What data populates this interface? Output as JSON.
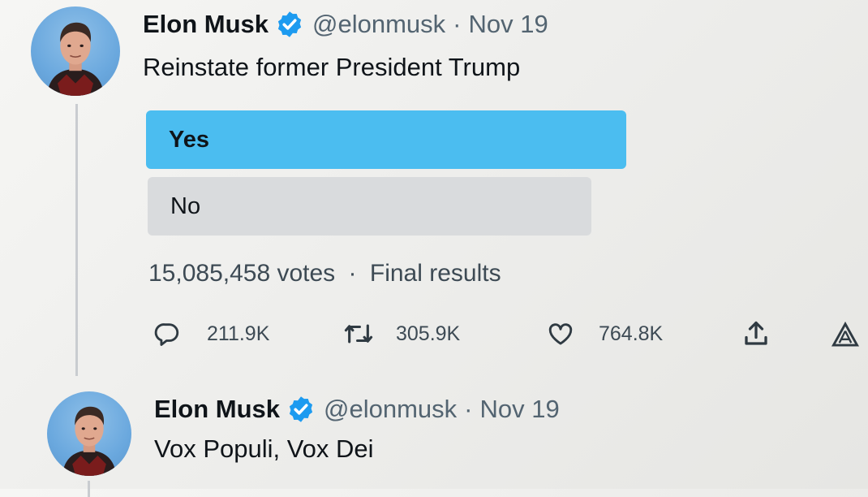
{
  "tweets": [
    {
      "author": "Elon Musk",
      "handle": "@elonmusk",
      "separator": "·",
      "date": "Nov 19",
      "text": "Reinstate former President Trump",
      "poll": {
        "options": [
          {
            "label": "Yes",
            "winner": true
          },
          {
            "label": "No",
            "winner": false
          }
        ],
        "votes": "15,085,458 votes",
        "status": "Final results"
      },
      "stats": {
        "replies": "211.9K",
        "retweets": "305.9K",
        "likes": "764.8K"
      }
    },
    {
      "author": "Elon Musk",
      "handle": "@elonmusk",
      "separator": "·",
      "date": "Nov 19",
      "text": "Vox Populi, Vox Dei"
    }
  ],
  "icons": {
    "verified": "verified-badge-icon",
    "reply": "reply-icon",
    "retweet": "retweet-icon",
    "like": "heart-icon",
    "share": "share-icon",
    "analytics": "analytics-icon"
  },
  "colors": {
    "accent": "#1d9bf0",
    "poll_winner": "#4bbdf0",
    "poll_other": "#d9dbdd",
    "secondary_text": "#536471"
  }
}
